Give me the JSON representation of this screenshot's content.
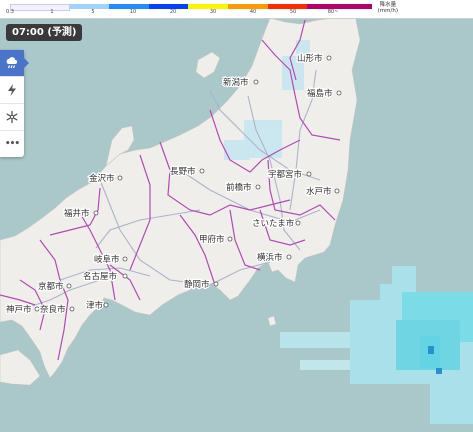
{
  "legend": {
    "ticks": [
      "0.3",
      "1",
      "5",
      "10",
      "20",
      "30",
      "40",
      "50",
      "80~"
    ],
    "unit_line1": "降水量",
    "unit_line2": "(mm/h)",
    "colors": [
      "#f2f2ff",
      "#a0d2ff",
      "#218cff",
      "#0041ff",
      "#faf500",
      "#ff9900",
      "#ff2800",
      "#b40068"
    ]
  },
  "forecast_time": "07:00 (予測)",
  "toolbar": {
    "rain_label": "降水",
    "lightning_label": "雷",
    "snow_label": "雪",
    "more_label": "•••"
  },
  "cities": [
    {
      "id": "yamagata",
      "name": "山形市"
    },
    {
      "id": "niigata",
      "name": "新潟市"
    },
    {
      "id": "fukushima",
      "name": "福島市"
    },
    {
      "id": "kanazawa",
      "name": "金沢市"
    },
    {
      "id": "nagano",
      "name": "長野市"
    },
    {
      "id": "utsunomiya",
      "name": "宇都宮市"
    },
    {
      "id": "maebashi",
      "name": "前橋市"
    },
    {
      "id": "mito",
      "name": "水戸市"
    },
    {
      "id": "fukui",
      "name": "福井市"
    },
    {
      "id": "saitama",
      "name": "さいたま市"
    },
    {
      "id": "kofu",
      "name": "甲府市"
    },
    {
      "id": "yokohama",
      "name": "横浜市"
    },
    {
      "id": "gifu",
      "name": "岐阜市"
    },
    {
      "id": "nagoya",
      "name": "名古屋市"
    },
    {
      "id": "kyoto",
      "name": "京都市"
    },
    {
      "id": "shizuoka",
      "name": "静岡市"
    },
    {
      "id": "tsu",
      "name": "津市"
    },
    {
      "id": "kobe",
      "name": "神戸市"
    },
    {
      "id": "nara",
      "name": "奈良市"
    }
  ]
}
